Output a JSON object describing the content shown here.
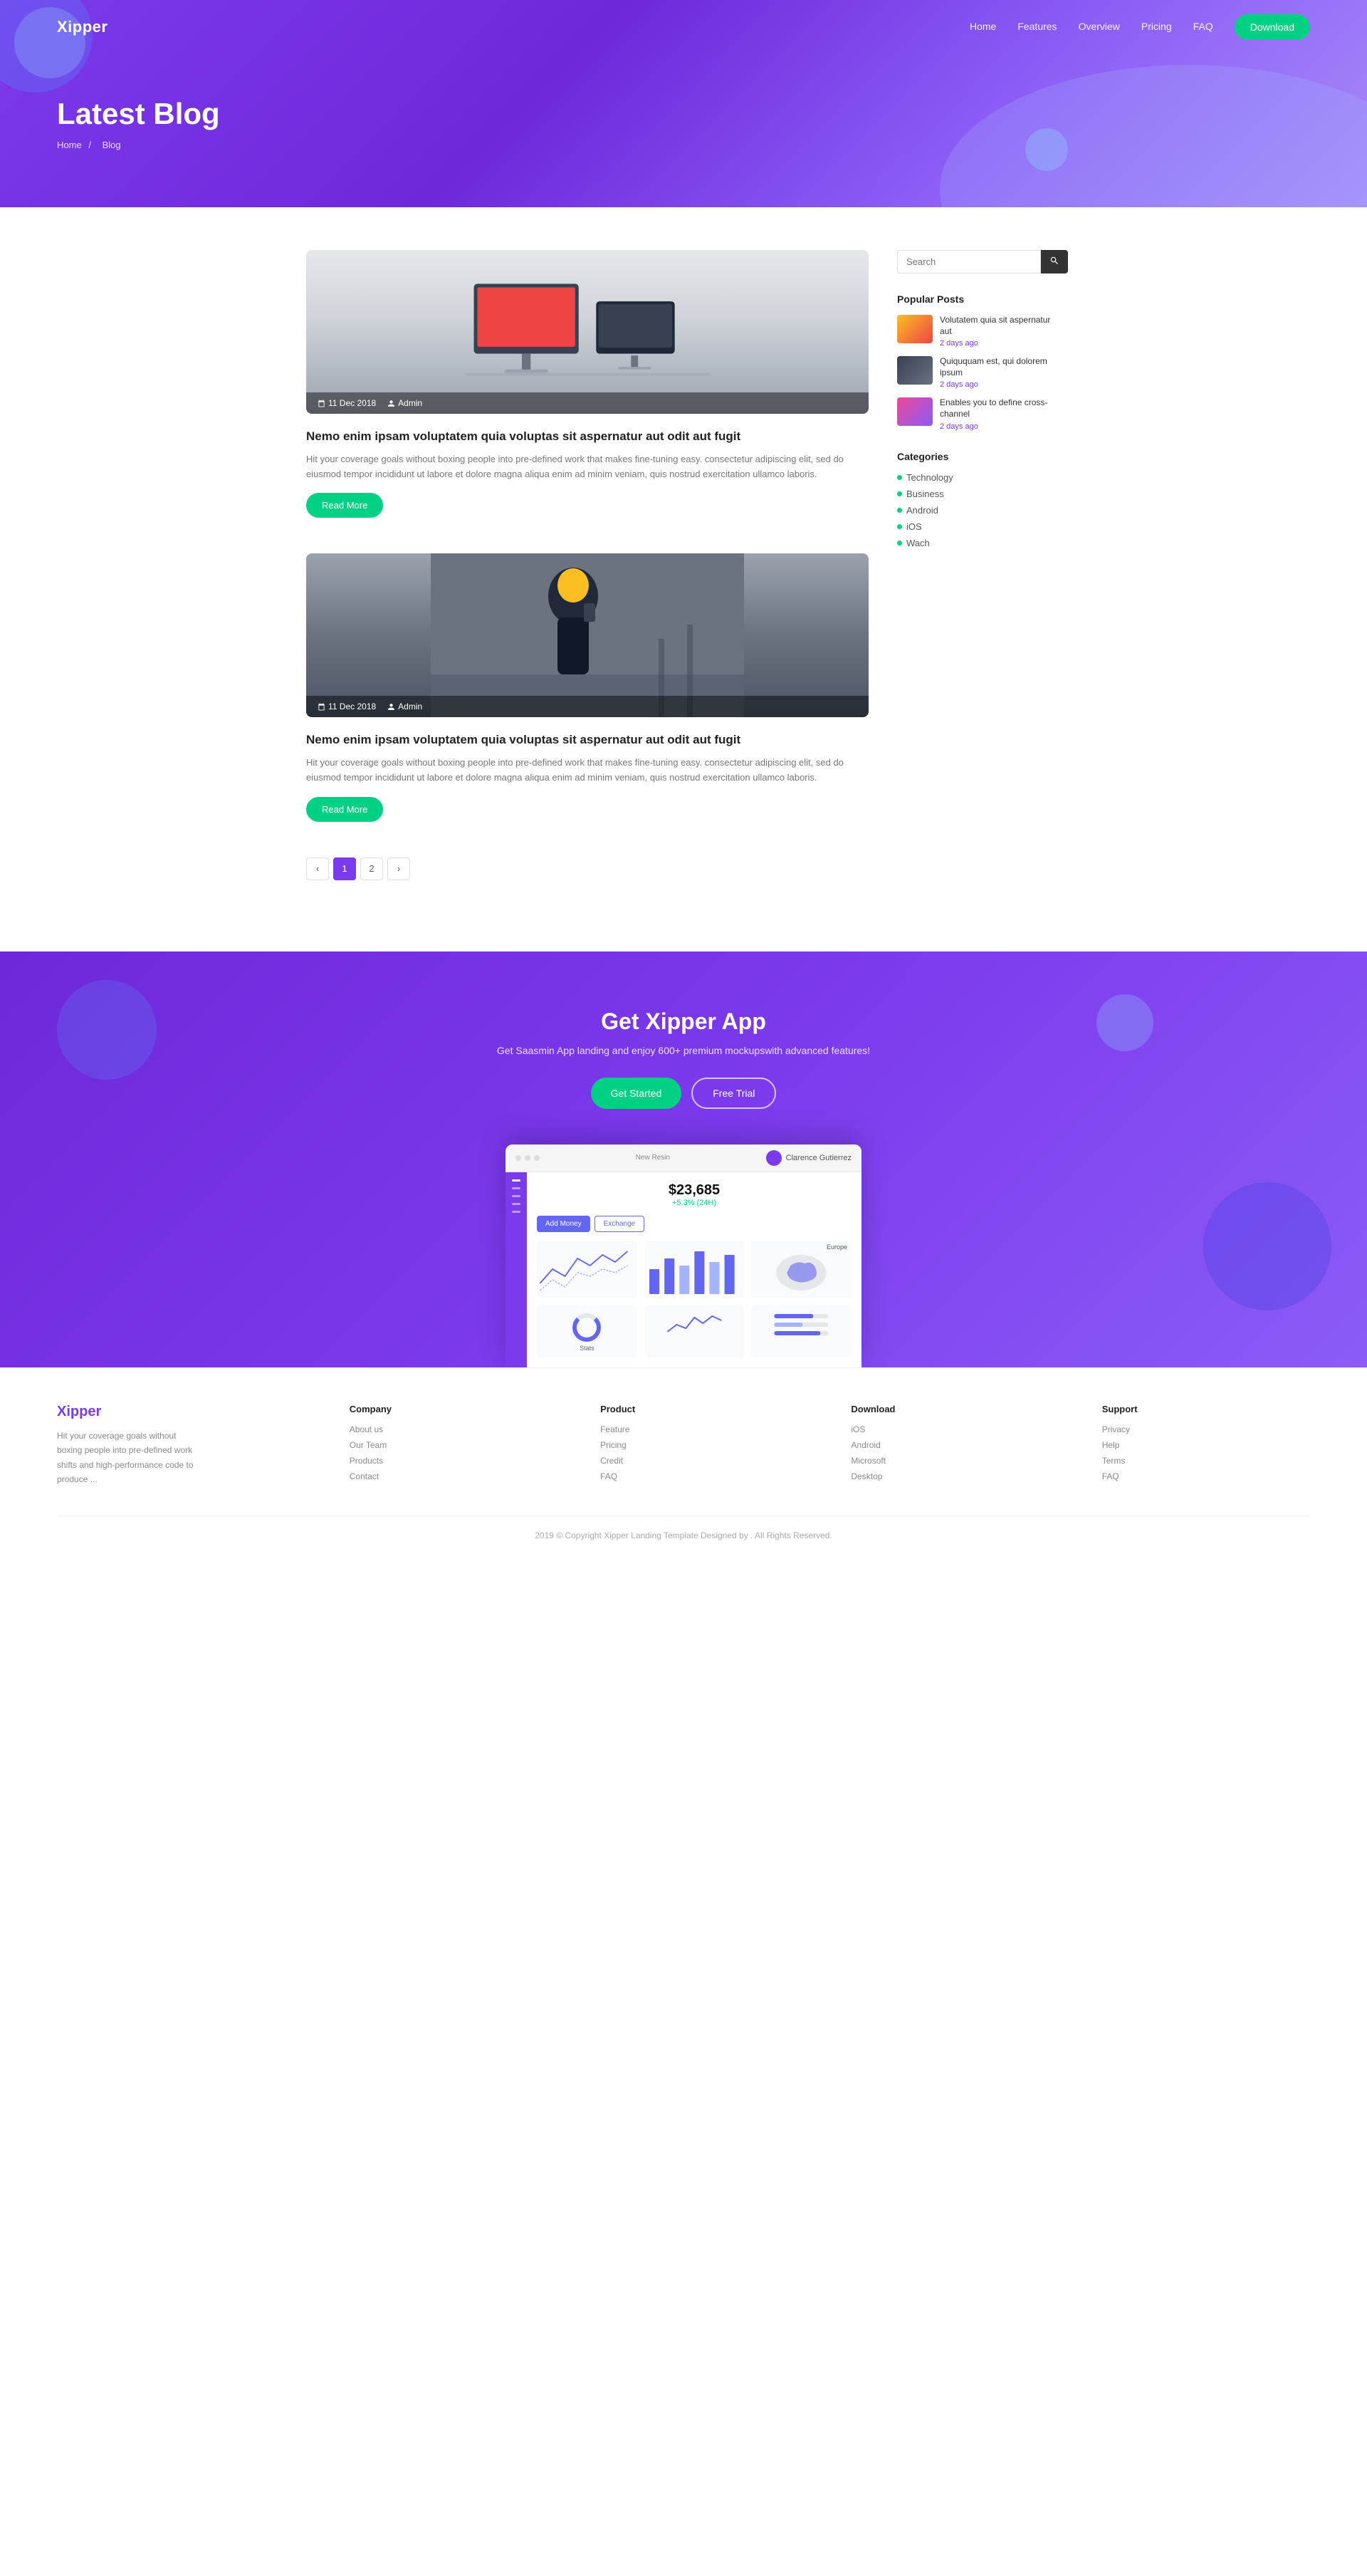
{
  "brand": {
    "logo": "Xipper"
  },
  "navbar": {
    "links": [
      {
        "label": "Home",
        "href": "#"
      },
      {
        "label": "Features",
        "href": "#"
      },
      {
        "label": "Overview",
        "href": "#"
      },
      {
        "label": "Pricing",
        "href": "#"
      },
      {
        "label": "FAQ",
        "href": "#"
      }
    ],
    "download_btn": "Download"
  },
  "hero": {
    "title": "Latest Blog",
    "breadcrumb_home": "Home",
    "breadcrumb_sep": "/",
    "breadcrumb_current": "Blog"
  },
  "blog": {
    "posts": [
      {
        "date": "11 Dec 2018",
        "author": "Admin",
        "title": "Nemo enim ipsam voluptatem quia voluptas sit aspernatur aut odit aut fugit",
        "excerpt": "Hit your coverage goals without boxing people into pre-defined work that makes fine-tuning easy. consectetur adipiscing elit, sed do eiusmod tempor incididunt ut labore et dolore magna aliqua  enim ad minim veniam, quis nostrud exercitation ullamco laboris.",
        "read_more": "Read More"
      },
      {
        "date": "11 Dec 2018",
        "author": "Admin",
        "title": "Nemo enim ipsam voluptatem quia voluptas sit aspernatur aut odit aut fugit",
        "excerpt": "Hit your coverage goals without boxing people into pre-defined work that makes fine-tuning easy. consectetur adipiscing elit, sed do eiusmod tempor incididunt ut labore et dolore magna aliqua  enim ad minim veniam, quis nostrud exercitation ullamco laboris.",
        "read_more": "Read More"
      }
    ]
  },
  "pagination": {
    "prev": "‹",
    "pages": [
      "1",
      "2"
    ],
    "next": "›"
  },
  "sidebar": {
    "search_placeholder": "Search",
    "popular_posts_title": "Popular Posts",
    "popular_posts": [
      {
        "title": "Volutatem quia sit aspernatur aut",
        "date": "2 days ago"
      },
      {
        "title": "Quiququam est, qui dolorem ipsum",
        "date": "2 days ago"
      },
      {
        "title": "Enables you to define cross-channel",
        "date": "2 days ago"
      }
    ],
    "categories_title": "Categories",
    "categories": [
      "Technology",
      "Business",
      "Android",
      "iOS",
      "Wach"
    ]
  },
  "cta": {
    "title": "Get Xipper App",
    "subtitle": "Get Saasmin App landing  and enjoy 600+ premium mockupswith advanced features!",
    "get_started": "Get Started",
    "free_trial": "Free Trial"
  },
  "mockup": {
    "user": "Clarence Gutierrez",
    "stat_label": "New Resin",
    "stat_value": "$23,685",
    "stat_change": "+5.3% (24H)",
    "btn1": "Add Money",
    "btn2": "Exchange"
  },
  "footer": {
    "logo": "Xipper",
    "desc": "Hit your coverage goals without boxing people into pre-defined work shifts and high-performance code to produce ...",
    "columns": [
      {
        "title": "Company",
        "links": [
          "About us",
          "Our Team",
          "Products",
          "Contact"
        ]
      },
      {
        "title": "Product",
        "links": [
          "Feature",
          "Pricing",
          "Credit",
          "FAQ"
        ]
      },
      {
        "title": "Download",
        "links": [
          "iOS",
          "Android",
          "Microsoft",
          "Desktop"
        ]
      },
      {
        "title": "Support",
        "links": [
          "Privacy",
          "Help",
          "Terms",
          "FAQ"
        ]
      }
    ],
    "copyright": "2019 © Copyright Xipper Landing Template Designed by . All Rights Reserved."
  }
}
